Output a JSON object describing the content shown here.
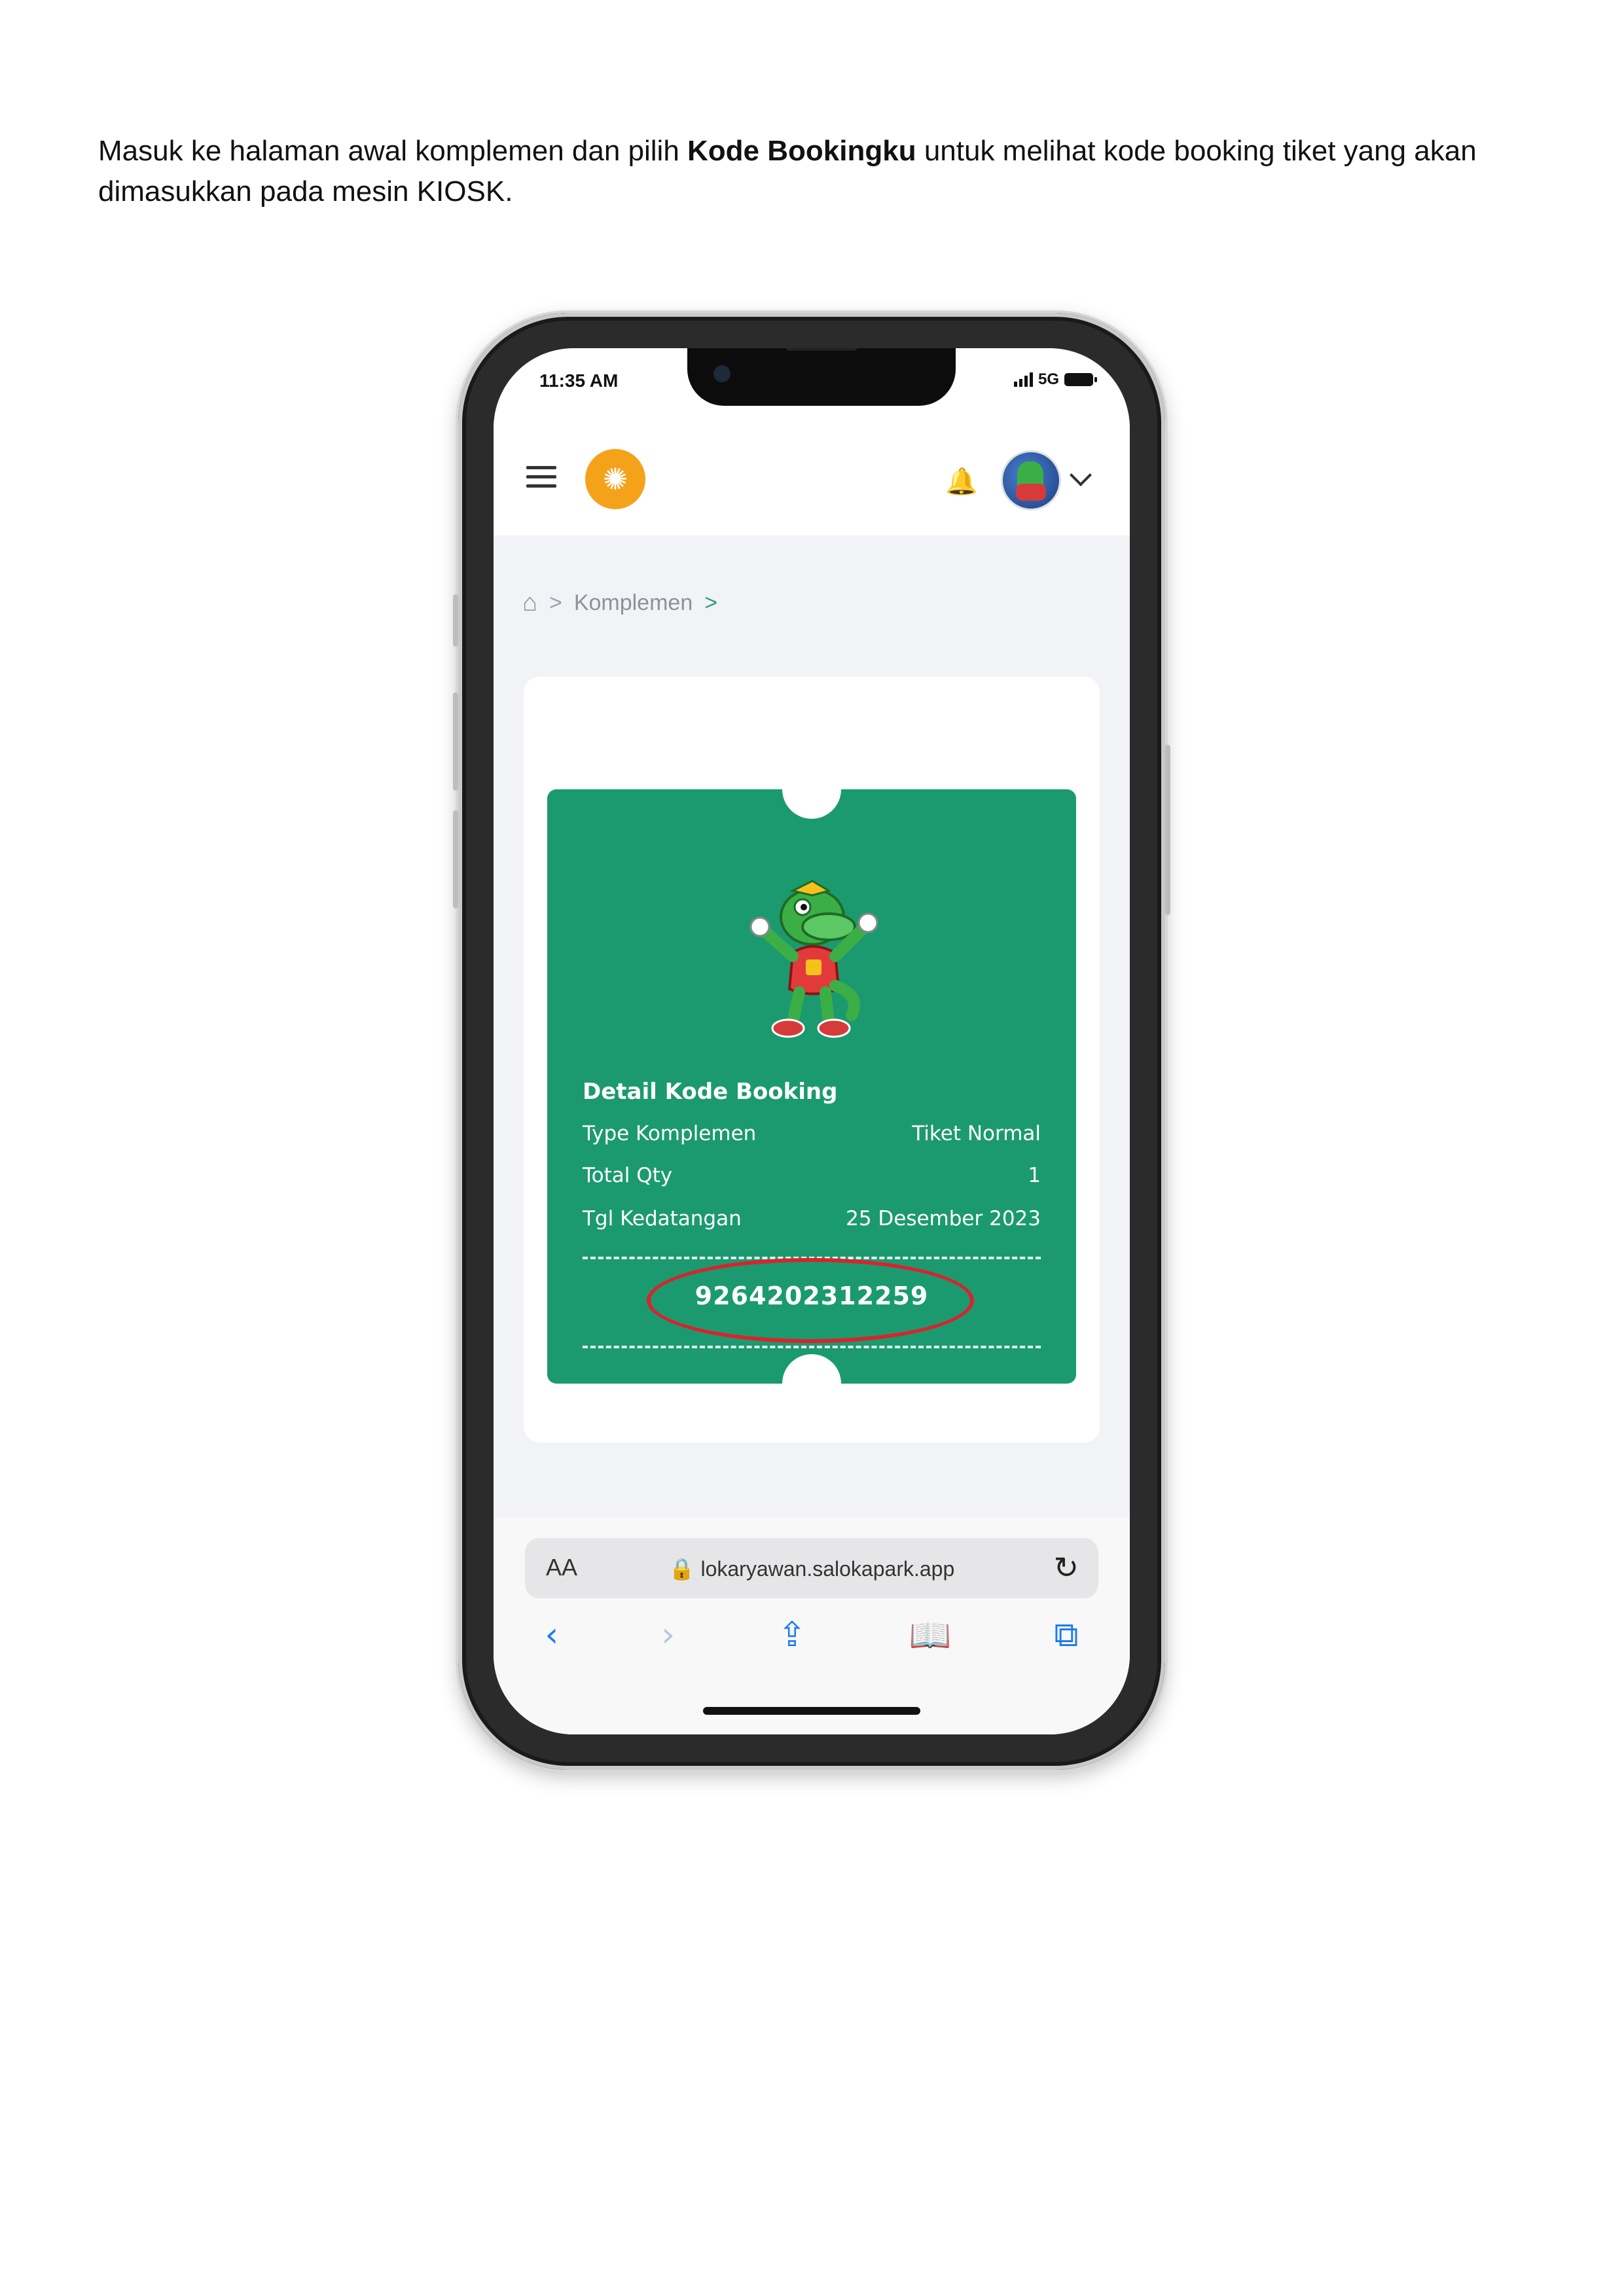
{
  "instruction": {
    "before": "Masuk ke halaman awal komplemen dan pilih ",
    "bold": "Kode Bookingku",
    "after": " untuk melihat kode booking tiket yang akan dimasukkan pada mesin KIOSK."
  },
  "status_bar": {
    "time": "11:35 AM",
    "network": "5G"
  },
  "breadcrumb": {
    "home": "⌂",
    "sep1": ">",
    "item": "Komplemen",
    "sep2": ">"
  },
  "ticket": {
    "title": "Detail Kode Booking",
    "rows": [
      {
        "label": "Type Komplemen",
        "value": "Tiket Normal"
      },
      {
        "label": "Total Qty",
        "value": "1"
      },
      {
        "label": "Tgl Kedatangan",
        "value": "25 Desember 2023"
      }
    ],
    "booking_code": "9264202312259"
  },
  "browser": {
    "aa": "AA",
    "url": "lokaryawan.salokapark.app"
  },
  "colors": {
    "ticket_green": "#1b9a70",
    "logo_orange": "#f5a21b",
    "highlight_red": "#d9232d",
    "ios_blue": "#1e7bf0"
  },
  "icons": [
    "hamburger-icon",
    "sun-icon",
    "bell-icon",
    "avatar",
    "chevron-down-icon",
    "home-icon",
    "lock-icon",
    "reload-icon",
    "back-icon",
    "forward-icon",
    "share-icon",
    "bookmarks-icon",
    "tabs-icon"
  ]
}
